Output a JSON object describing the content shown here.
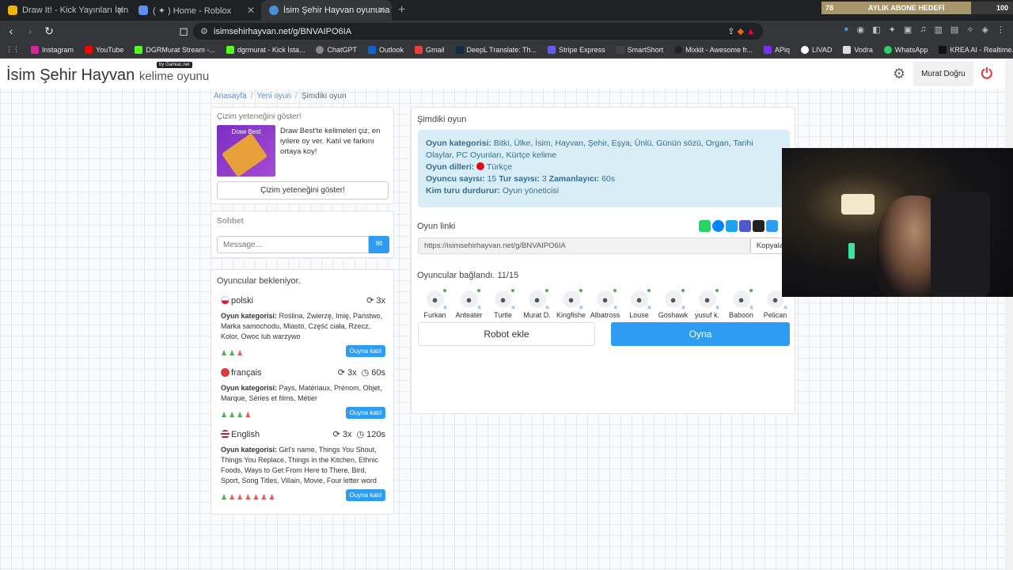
{
  "browser": {
    "tabs": [
      {
        "title": "Draw It! - Kick Yayınları İçin Çizim ve",
        "color": "#f0b400",
        "active": false
      },
      {
        "title": "( ✦ ) Home - Roblox",
        "color": "#5b8ef0",
        "active": false
      },
      {
        "title": "İsim Şehir Hayvan oyununa katıl",
        "color": "#4a90d9",
        "active": true
      }
    ],
    "new_tab": "+",
    "url": "isimsehirhayvan.net/g/BNVAIPO6IA",
    "bookmarks": [
      "Instagram",
      "YouTube",
      "DGRMurat Stream -...",
      "dgrmurat - Kick İsta...",
      "ChatGPT",
      "Outlook",
      "Gmail",
      "DeepL Translate: Th...",
      "Stripe Express",
      "SmartShort",
      "Mixkit - Awesome fr...",
      "APiq",
      "LIVAD",
      "Vodra",
      "WhatsApp",
      "KREA AI - Realtime..."
    ]
  },
  "overlay": {
    "goal_start": "78",
    "goal_label": "AYLIK ABONE HEDEFİ",
    "goal_end": "100",
    "goal_fraction": 0.78
  },
  "header": {
    "logo_main": "İsim Şehir Hayvan",
    "logo_sub": "kelime oyunu",
    "badge": "by Gamiac.net",
    "user": "Murat Doğru"
  },
  "breadcrumb": {
    "home": "Anasayfa",
    "new": "Yeni oyun",
    "current": "Şimdiki oyun"
  },
  "draw_card": {
    "title": "Çizim yeteneğini göster!",
    "img_label": "Draw Best",
    "text": "Draw Best'te kelimeleri çiz, en iyilere oy ver. Katıl ve farkını ortaya koy!",
    "button": "Çizim yeteneğini göster!"
  },
  "chat": {
    "title": "Sohbet",
    "placeholder": "Message..."
  },
  "waiting": {
    "title": "Oyuncular bekleniyor.",
    "join": "Ouyna katıl",
    "label": "Oyun kategorisi:",
    "langs": [
      {
        "name": "polski",
        "flag": "pl",
        "rounds": "3x",
        "timer": "",
        "cats": "Roślina, Zwierzę, Imię, Państwo, Marka samochodu, Miasto, Część ciała, Rzecz, Kolor, Owoc lub warzywo",
        "players": "ggr"
      },
      {
        "name": "français",
        "flag": "fr",
        "rounds": "3x",
        "timer": "60s",
        "cats": "Pays, Matériaux, Prénom, Objet, Marque, Séries et films, Métier",
        "players": "gggr"
      },
      {
        "name": "English",
        "flag": "us",
        "rounds": "3x",
        "timer": "120s",
        "cats": "Girl's name, Things You Shout, Things You Replace, Things in the Kitchen, Ethnic Foods, Ways to Get From Here to There, Bird, Sport, Song Titles, Villain, Movie, Four letter word",
        "players": "grrrrrr"
      }
    ]
  },
  "game": {
    "title": "Şimdiki oyun",
    "cat_label": "Oyun kategorisi:",
    "cats": "Bitki, Ülke, İsim, Hayvan, Şehir, Eşya, Ünlü, Günün sözü, Organ, Tarihi Olaylar, PC Oyunları, Kürtçe kelime",
    "lang_label": "Oyun dilleri:",
    "lang": "Türkçe",
    "players_label": "Oyuncu sayısı:",
    "players": "15",
    "rounds_label": "Tur sayısı:",
    "rounds": "3",
    "timer_label": "Zamanlayıcı:",
    "timer": "60s",
    "stop_label": "Kim turu durdurur:",
    "stop": "Oyun yöneticisi",
    "link_label": "Oyun linki",
    "link": "https://isimsehirhayvan.net/g/BNVAIPO6IA",
    "copy": "Kopyala",
    "connected": "Oyuncular bağlandı. 11/15",
    "names": [
      "Furkan",
      "Anteater",
      "Turtle",
      "Murat D.",
      "Kingfishe",
      "Albatross",
      "Louse",
      "Goshawk",
      "yusuf k.",
      "Baboon",
      "Pelican"
    ],
    "robot": "Robot ekle",
    "play": "Oyna"
  }
}
